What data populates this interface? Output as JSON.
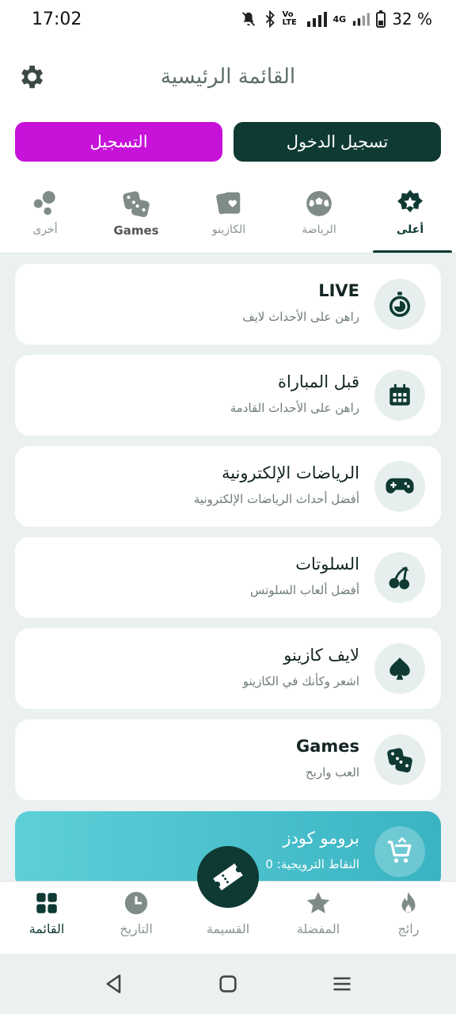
{
  "status_bar": {
    "time": "17:02",
    "network_label": "4G",
    "volte_label": "Vo LTE",
    "battery": "32 %"
  },
  "header": {
    "title": "القائمة الرئيسية",
    "login_label": "تسجيل الدخول",
    "register_label": "التسجيل"
  },
  "tabs": [
    {
      "label": "أعلى",
      "icon": "star-badge-icon",
      "active": true
    },
    {
      "label": "الرياضة",
      "icon": "soccer-ball-icon"
    },
    {
      "label": "الكازينو",
      "icon": "playing-cards-icon"
    },
    {
      "label": "Games",
      "icon": "dice-icon"
    },
    {
      "label": "أخرى",
      "icon": "bubbles-icon"
    }
  ],
  "menu": [
    {
      "title": "LIVE",
      "subtitle": "راهن على الأحداث لايف",
      "icon": "stopwatch-icon"
    },
    {
      "title": "قبل المباراة",
      "subtitle": "راهن على الأحداث القادمة",
      "icon": "calendar-icon"
    },
    {
      "title": "الرياضات الإلكترونية",
      "subtitle": "أفضل أحداث الرياضات الإلكترونية",
      "icon": "gamepad-icon"
    },
    {
      "title": "السلوتات",
      "subtitle": "أفضل ألعاب السلوتس",
      "icon": "cherry-icon"
    },
    {
      "title": "لايف كازينو",
      "subtitle": "اشعر وكأنك في الكازينو",
      "icon": "spade-icon"
    },
    {
      "title": "Games",
      "subtitle": "العب واربح",
      "icon": "dice-icon"
    },
    {
      "title": "برومو كودز",
      "subtitle": "النقاط الترويجية: 0",
      "icon": "cart-icon"
    }
  ],
  "bottom_nav": [
    {
      "label": "رائج",
      "icon": "flame-icon"
    },
    {
      "label": "المفضلة",
      "icon": "star-icon"
    },
    {
      "label": "القسيمة",
      "icon": "ticket-icon"
    },
    {
      "label": "التاريخ",
      "icon": "clock-icon"
    },
    {
      "label": "القائمة",
      "icon": "grid-icon",
      "active": true
    }
  ],
  "colors": {
    "primary": "#0e3a33",
    "register": "#c612d9",
    "promo_start": "#5dcfd8",
    "promo_end": "#3ab4c2",
    "background": "#eaf1f0"
  }
}
